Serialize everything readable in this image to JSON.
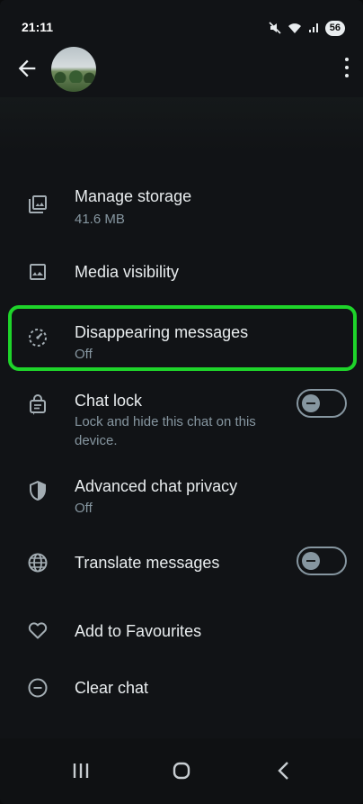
{
  "status_bar": {
    "time": "21:11",
    "battery": "56"
  },
  "header": {
    "back_icon": "arrow-left-icon",
    "menu_icon": "more-vert-icon"
  },
  "settings": [
    {
      "icon": "folder-storage-icon",
      "title": "Manage storage",
      "subtitle": "41.6 MB"
    },
    {
      "icon": "image-icon",
      "title": "Media visibility"
    },
    {
      "icon": "timer-icon",
      "title": "Disappearing messages",
      "subtitle": "Off"
    },
    {
      "icon": "chat-lock-icon",
      "title": "Chat lock",
      "subtitle": "Lock and hide this chat on this device.",
      "toggle": false
    },
    {
      "icon": "shield-icon",
      "title": "Advanced chat privacy",
      "subtitle": "Off"
    },
    {
      "icon": "globe-icon",
      "title": "Translate messages",
      "toggle": false
    },
    {
      "icon": "heart-icon",
      "title": "Add to Favourites"
    },
    {
      "icon": "minus-circle-icon",
      "title": "Clear chat"
    }
  ],
  "colors": {
    "highlight": "#1ed42a",
    "background": "#111316",
    "text": "#e9edef",
    "secondary_text": "#8696a0"
  }
}
